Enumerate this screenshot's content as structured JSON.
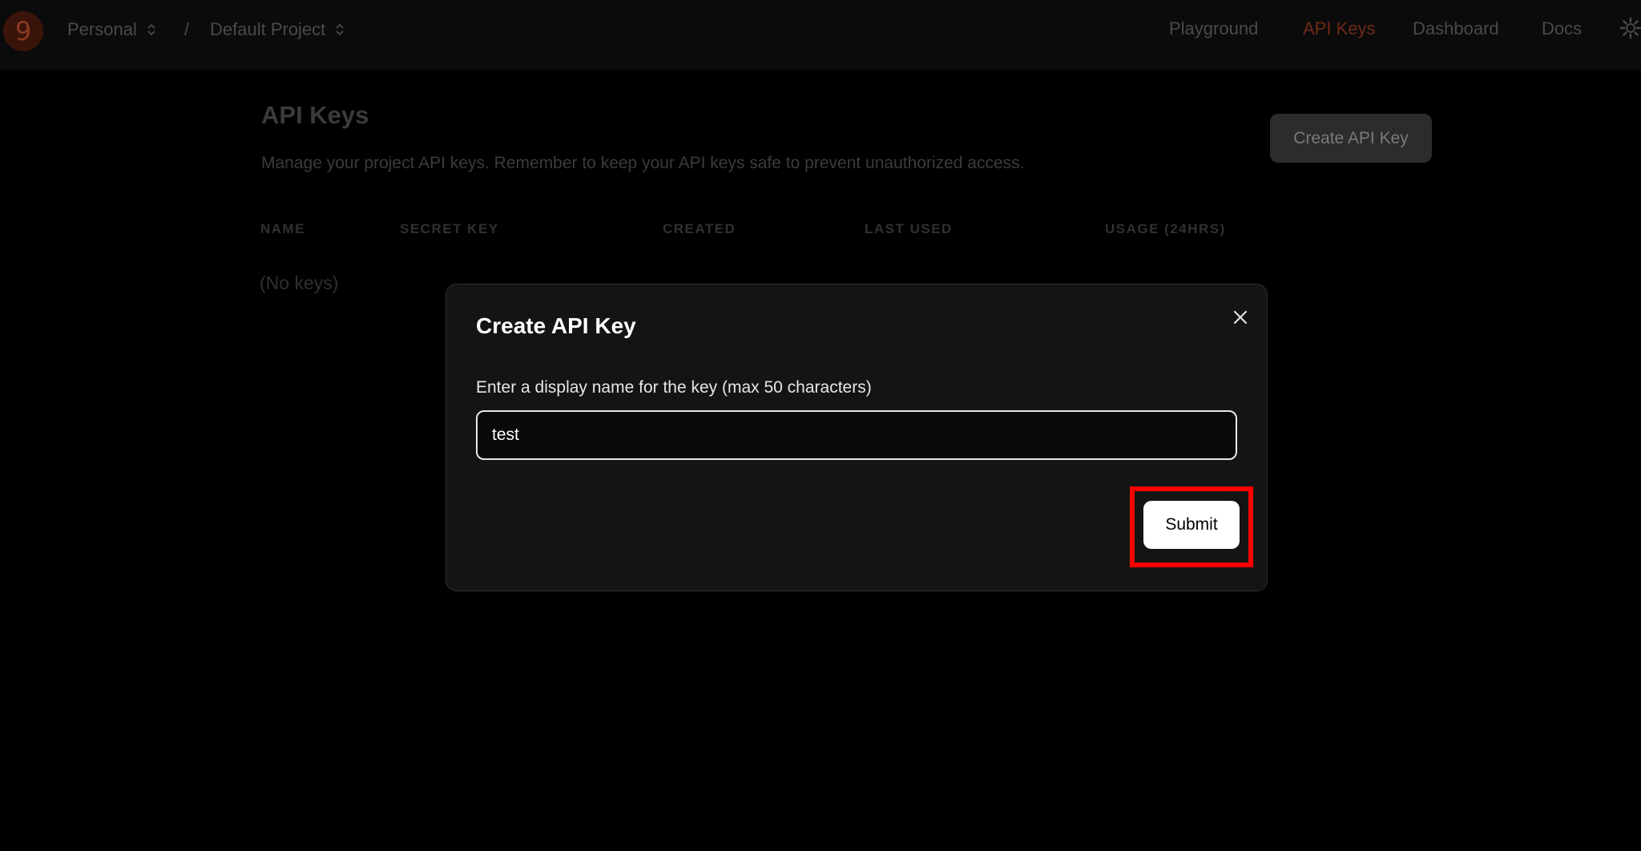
{
  "topbar": {
    "logo_text": "9",
    "org": "Personal",
    "separator": "/",
    "project": "Default Project",
    "nav": [
      {
        "label": "Playground",
        "active": false
      },
      {
        "label": "API Keys",
        "active": true
      },
      {
        "label": "Dashboard",
        "active": false
      },
      {
        "label": "Docs",
        "active": false
      }
    ]
  },
  "page": {
    "title": "API Keys",
    "subtitle": "Manage your project API keys. Remember to keep your API keys safe to prevent unauthorized access.",
    "create_button": "Create API Key",
    "columns": [
      "NAME",
      "SECRET KEY",
      "CREATED",
      "LAST USED",
      "USAGE (24HRS)"
    ],
    "empty_text": "(No keys)"
  },
  "modal": {
    "title": "Create API Key",
    "label": "Enter a display name for the key (max 50 characters)",
    "input_value": "test",
    "submit_label": "Submit"
  },
  "colors": {
    "accent_active": "#6e2a18",
    "highlight": "#ff0000"
  }
}
